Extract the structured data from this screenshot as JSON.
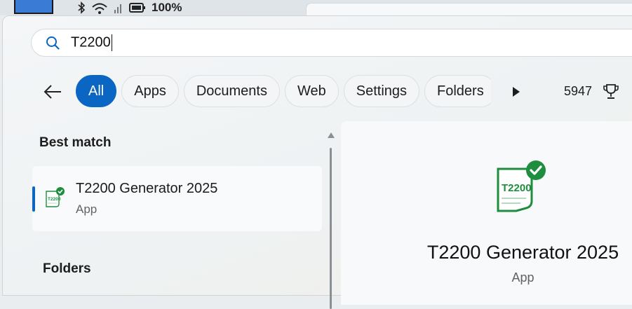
{
  "status_bar": {
    "battery_text": "100%"
  },
  "search": {
    "query": "T2200",
    "icon": "search-icon"
  },
  "filters": {
    "back_icon": "back-arrow-icon",
    "tabs": [
      {
        "label": "All",
        "active": true
      },
      {
        "label": "Apps",
        "active": false
      },
      {
        "label": "Documents",
        "active": false
      },
      {
        "label": "Web",
        "active": false
      },
      {
        "label": "Settings",
        "active": false
      },
      {
        "label": "Folders",
        "active": false
      }
    ],
    "more_icon": "play-arrow-icon",
    "rewards_points": "5947",
    "rewards_icon": "trophy-icon"
  },
  "results": {
    "best_match_heading": "Best match",
    "best_match": {
      "title": "T2200 Generator 2025",
      "type": "App",
      "icon_text": "T2200"
    },
    "folders_heading": "Folders"
  },
  "preview": {
    "title": "T2200 Generator 2025",
    "type": "App",
    "icon_text": "T2200"
  },
  "colors": {
    "accent": "#0a66c2",
    "app_icon_green": "#1e8e3e"
  }
}
